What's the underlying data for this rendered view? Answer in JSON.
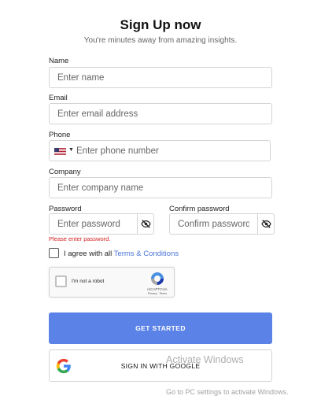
{
  "header": {
    "title": "Sign Up now",
    "subtitle": "You're minutes away from amazing insights."
  },
  "form": {
    "name": {
      "label": "Name",
      "placeholder": "Enter name",
      "value": ""
    },
    "email": {
      "label": "Email",
      "placeholder": "Enter email address",
      "value": ""
    },
    "phone": {
      "label": "Phone",
      "placeholder": "Enter phone number",
      "value": "",
      "country_flag_icon": "us-flag-icon"
    },
    "company": {
      "label": "Company",
      "placeholder": "Enter company name",
      "value": ""
    },
    "password": {
      "label": "Password",
      "placeholder": "Enter password",
      "value": "",
      "toggle_icon": "eye-slash-icon"
    },
    "confirm_password": {
      "label": "Confirm password",
      "placeholder": "Confirm password",
      "value": "",
      "toggle_icon": "eye-slash-icon"
    },
    "password_error": "Please enter password.",
    "terms": {
      "checked": false,
      "prefix": "I agree with all",
      "link": "Terms & Conditions"
    }
  },
  "recaptcha": {
    "label": "I'm not a robot",
    "brand": "reCAPTCHA",
    "links": "Privacy - Terms"
  },
  "buttons": {
    "primary": "GET STARTED",
    "google": "SIGN IN WITH GOOGLE"
  },
  "watermark": {
    "line1": "Activate Windows",
    "line2": "Go to PC settings to activate Windows."
  },
  "colors": {
    "primary": "#5b82e6",
    "link": "#4a73d6",
    "error": "#d32020"
  }
}
